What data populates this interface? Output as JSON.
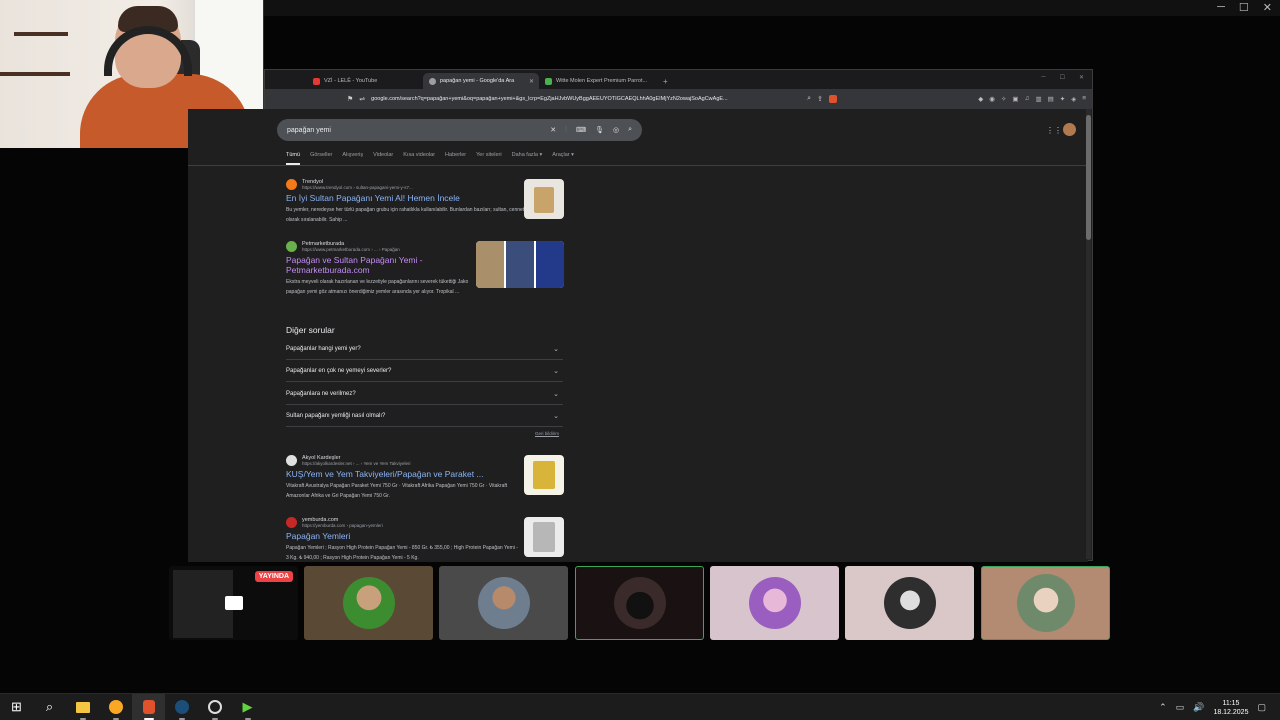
{
  "browser": {
    "tabs": [
      {
        "label": "VZİ - LELÊ - YouTube",
        "color": "#e53935"
      },
      {
        "label": "papağan yemi - Google'da Ara",
        "color": "#9e9e9e"
      },
      {
        "label": "Witte Molen Expert Premium Parrot...",
        "color": "#4caf50"
      }
    ],
    "url": "google.com/search?q=papağan+yemi&oq=papağan+yemi+&gs_lcrp=EgZjaHJvbWUyBggAEEUYOTIGCAEQLhhA0gEIMjYzN2owajSoAgCwAgE..."
  },
  "search": {
    "query": "papağan yemi",
    "nav_tabs": [
      "Tümü",
      "Görseller",
      "Alışveriş",
      "Videolar",
      "Kısa videolar",
      "Haberler",
      "Yer siteleri",
      "Daha fazla ▾",
      "Araçlar ▾"
    ]
  },
  "results": [
    {
      "site": "Trendyol",
      "url": "https://www.trendyol.com › sultan-papagani-yemi-y-s7...",
      "title": "En İyi Sultan Papağanı Yemi Al! Hemen İncele",
      "snippet": "Bu yemler, neredeyse her türlü papağan grubu için rahatlıkla kullanılabilir. Bunlardan bazıları; sultan, cennet, forpus, kakariki olarak sıralanabilir. Sahip ..."
    },
    {
      "site": "Petmarketburada",
      "url": "https://www.petmarketburada.com › ... › Papağan",
      "title": "Papağan ve Sultan Papağanı Yemi - Petmarketburada.com",
      "snippet": "Ekstra meyveli olarak hazırlanan ve lezzetiyle papağanlarını severek tükettiği Jako papağan yemi göz atmanızı önerdiğimiz yemler arasında yer alıyor. Tropikal ..."
    },
    {
      "site": "Akyol Kardeşler",
      "url": "https://akyolkardesler.net › ... › Yem ve Yem Takviyeleri",
      "title": "KUŞ/Yem ve Yem Takviyeleri/Papağan ve Paraket ...",
      "snippet": "Vitakraft Avustralya Papağan Paraket Yemi 750 Gr · Vitakraft Afrika Papağan Yemi 750 Gr · Vitakraft Amazonlar Afrika ve Gri Papağan Yemi 750 Gr."
    },
    {
      "site": "yemburda.com",
      "url": "https://yemburda.com › papagan-yemleri",
      "title": "Papağan Yemleri",
      "snippet": "Papağan Yemleri ; Rasyon High Protein Papağan Yemi - 850 Gr. ₺ 355,00 ; High Protein Papağan Yemi - 3 Kg. ₺ 940,00 ; Rasyon High Protein Papağan Yemi - 5 Kg."
    }
  ],
  "paa": {
    "title": "Diğer sorular",
    "questions": [
      "Papağanlar hangi yemi yer?",
      "Papağanlar en çok ne yemeyi severler?",
      "Papağanlara ne verilmez?",
      "Sultan papağanı yemliği nasıl olmalı?"
    ],
    "feedback": "Geri bildirim"
  },
  "call": {
    "live_badge": "YAYINDA"
  },
  "taskbar": {
    "time": "11:15",
    "date": "18.12.2025"
  },
  "colors": {
    "link": "#8ab4f8",
    "visited": "#c58af9",
    "live": "#ed4245",
    "speaking": "#3ba55c"
  }
}
